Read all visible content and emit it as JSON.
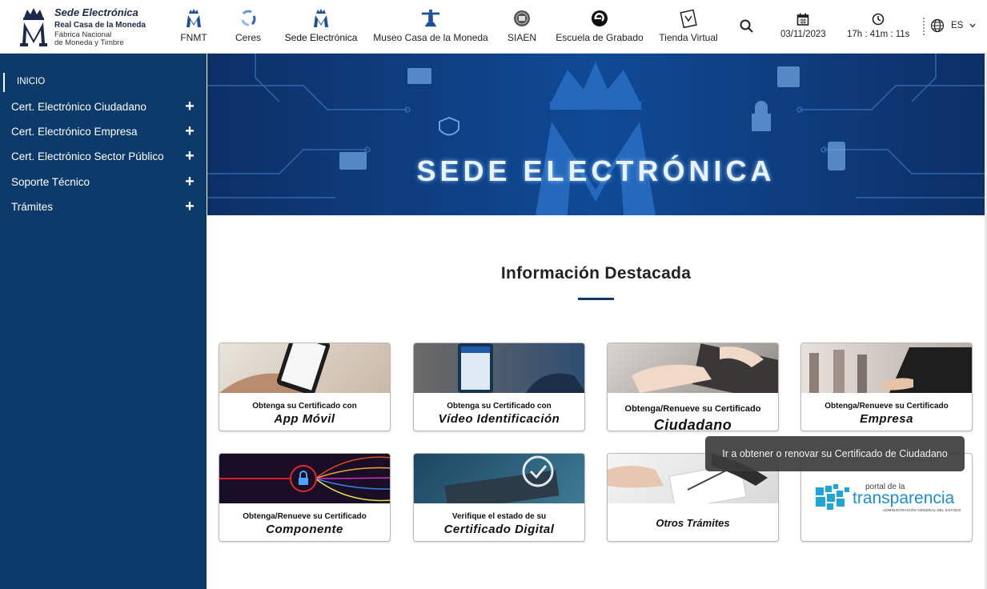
{
  "header": {
    "logo": {
      "title": "Sede Electrónica",
      "line2": "Real Casa de la Moneda",
      "line3": "Fábrica Nacional",
      "line4": "de Moneda y Timbre"
    },
    "nav": [
      {
        "label": "FNMT",
        "icon": "fnmt-icon"
      },
      {
        "label": "Ceres",
        "icon": "ceres-icon"
      },
      {
        "label": "Sede Electrónica",
        "icon": "sede-icon"
      },
      {
        "label": "Museo Casa de la Moneda",
        "icon": "museo-icon"
      },
      {
        "label": "SIAEN",
        "icon": "siaen-icon"
      },
      {
        "label": "Escuela de Grabado",
        "icon": "escuela-icon"
      },
      {
        "label": "Tienda Virtual",
        "icon": "tienda-icon"
      }
    ],
    "date": "03/11/2023",
    "time": "17h : 41m : 11s",
    "language": "ES"
  },
  "sidebar": {
    "home": "INICIO",
    "items": [
      {
        "label": "Cert. Electrónico Ciudadano"
      },
      {
        "label": "Cert. Electrónico Empresa"
      },
      {
        "label": "Cert. Electrónico Sector Público"
      },
      {
        "label": "Soporte Técnico"
      },
      {
        "label": "Trámites"
      }
    ]
  },
  "banner": {
    "title": "SEDE ELECTRÓNICA"
  },
  "main": {
    "section_title": "Información Destacada",
    "cards": [
      {
        "line1": "Obtenga su Certificado con",
        "line2": "App Móvil"
      },
      {
        "line1": "Obtenga su Certificado con",
        "line2": "Vídeo Identificación"
      },
      {
        "line1": "Obtenga/Renueve su Certificado",
        "line2": "Ciudadano"
      },
      {
        "line1": "Obtenga/Renueve su Certificado",
        "line2": "Empresa"
      },
      {
        "line1": "Obtenga/Renueve su Certificado",
        "line2": "Componente"
      },
      {
        "line1": "Verifique el estado de su",
        "line2": "Certificado Digital"
      },
      {
        "line1": "Otros Trámites"
      },
      {
        "logo_text_small": "portal de la",
        "logo_text_big": "transparencia",
        "logo_sub": "ADMINISTRACIÓN GENERAL DEL ESTADO"
      }
    ],
    "tooltip": "Ir a obtener o renovar su Certificado de Ciudadano"
  },
  "colors": {
    "sidebar": "#0b3a6b",
    "banner": "#0f4a95",
    "accent": "#0b3a6b"
  }
}
